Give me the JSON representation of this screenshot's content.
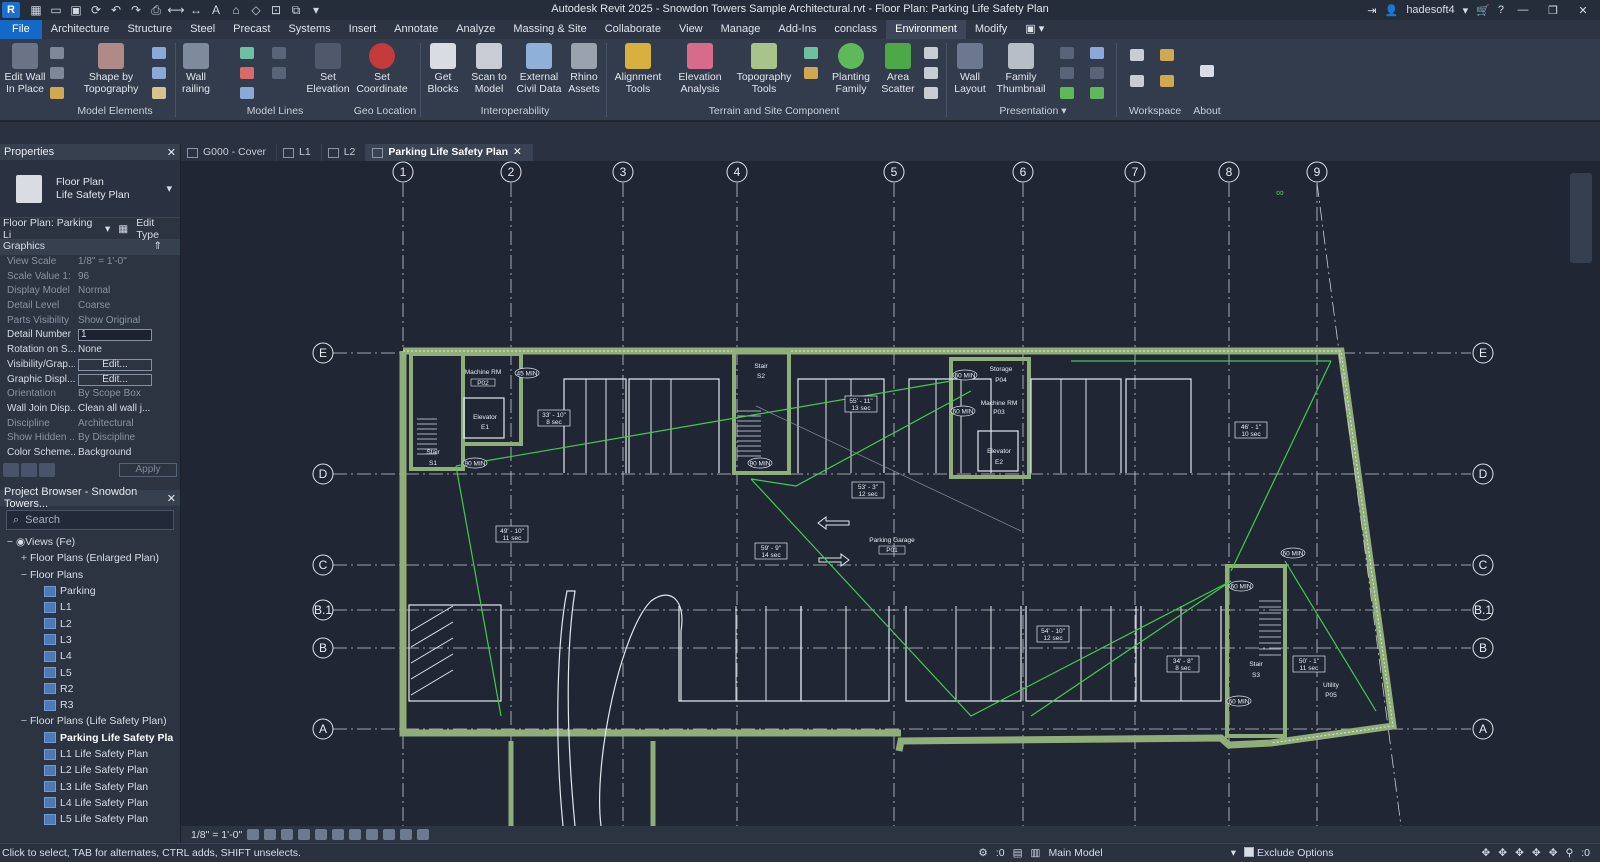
{
  "window": {
    "title": "Autodesk Revit 2025 - Snowdon Towers Sample Architectural.rvt - Floor Plan: Parking Life Safety Plan",
    "user": "hadesoft4",
    "logo": "R"
  },
  "menu": {
    "tabs": [
      "File",
      "Architecture",
      "Structure",
      "Steel",
      "Precast",
      "Systems",
      "Insert",
      "Annotate",
      "Analyze",
      "Massing & Site",
      "Collaborate",
      "View",
      "Manage",
      "Add-Ins",
      "conclass",
      "Environment",
      "Modify"
    ],
    "active": "Environment"
  },
  "ribbon": {
    "buttons": {
      "edit_wall": "Edit Wall In Place",
      "shape_topo": "Shape by Topography",
      "wall_railing": "Wall railing",
      "set_elevation": "Set Elevation",
      "set_coordinate": "Set Coordinate",
      "get_blocks": "Get Blocks",
      "scan_model": "Scan to Model",
      "external_civil": "External Civil Data",
      "rhino_assets": "Rhino Assets",
      "alignment_tools": "Alignment Tools",
      "elevation_analysis": "Elevation Analysis",
      "topography_tools": "Topography Tools",
      "planting_family": "Planting Family",
      "area_scatter": "Area Scatter",
      "wall_layout": "Wall Layout",
      "family_thumbnail": "Family Thumbnail"
    },
    "panels": {
      "model_elements": "Model Elements",
      "model_lines": "Model Lines",
      "geo_location": "Geo Location",
      "interoperability": "Interoperability",
      "terrain": "Terrain and Site Component",
      "presentation": "Presentation",
      "workspace": "Workspace",
      "about": "About"
    }
  },
  "properties": {
    "title": "Properties",
    "type_line1": "Floor Plan",
    "type_line2": "Life Safety Plan",
    "instance": "Floor Plan: Parking Li",
    "edit_type": "Edit Type",
    "section": "Graphics",
    "rows": [
      {
        "k": "View Scale",
        "v": "1/8\" = 1'-0\"",
        "dim": true,
        "kind": "text"
      },
      {
        "k": "Scale Value    1:",
        "v": "96",
        "dim": true,
        "kind": "text"
      },
      {
        "k": "Display Model",
        "v": "Normal",
        "dim": true,
        "kind": "text"
      },
      {
        "k": "Detail Level",
        "v": "Coarse",
        "dim": true,
        "kind": "text"
      },
      {
        "k": "Parts Visibility",
        "v": "Show Original",
        "dim": true,
        "kind": "text"
      },
      {
        "k": "Detail Number",
        "v": "1",
        "dim": false,
        "kind": "input"
      },
      {
        "k": "Rotation on S...",
        "v": "None",
        "dim": false,
        "kind": "text"
      },
      {
        "k": "Visibility/Grap...",
        "v": "Edit...",
        "dim": false,
        "kind": "button"
      },
      {
        "k": "Graphic Displ...",
        "v": "Edit...",
        "dim": false,
        "kind": "button"
      },
      {
        "k": "Orientation",
        "v": "By Scope Box",
        "dim": true,
        "kind": "text"
      },
      {
        "k": "Wall Join Disp...",
        "v": "Clean all wall j...",
        "dim": false,
        "kind": "text"
      },
      {
        "k": "Discipline",
        "v": "Architectural",
        "dim": true,
        "kind": "text"
      },
      {
        "k": "Show Hidden ...",
        "v": "By Discipline",
        "dim": true,
        "kind": "text"
      },
      {
        "k": "Color Scheme...",
        "v": "Background",
        "dim": false,
        "kind": "text"
      }
    ],
    "apply": "Apply"
  },
  "browser": {
    "title": "Project Browser - Snowdon Towers...",
    "search_placeholder": "Search",
    "nodes": [
      {
        "label": "Views (Fe)",
        "level": 0,
        "toggle": "−",
        "icon": false,
        "sel": false
      },
      {
        "label": "Floor Plans (Enlarged Plan)",
        "level": 1,
        "toggle": "+",
        "icon": false,
        "sel": false
      },
      {
        "label": "Floor Plans",
        "level": 1,
        "toggle": "−",
        "icon": false,
        "sel": false
      },
      {
        "label": "Parking",
        "level": 2,
        "toggle": "",
        "icon": true,
        "sel": false
      },
      {
        "label": "L1",
        "level": 2,
        "toggle": "",
        "icon": true,
        "sel": false
      },
      {
        "label": "L2",
        "level": 2,
        "toggle": "",
        "icon": true,
        "sel": false
      },
      {
        "label": "L3",
        "level": 2,
        "toggle": "",
        "icon": true,
        "sel": false
      },
      {
        "label": "L4",
        "level": 2,
        "toggle": "",
        "icon": true,
        "sel": false
      },
      {
        "label": "L5",
        "level": 2,
        "toggle": "",
        "icon": true,
        "sel": false
      },
      {
        "label": "R2",
        "level": 2,
        "toggle": "",
        "icon": true,
        "sel": false
      },
      {
        "label": "R3",
        "level": 2,
        "toggle": "",
        "icon": true,
        "sel": false
      },
      {
        "label": "Floor Plans (Life Safety Plan)",
        "level": 1,
        "toggle": "−",
        "icon": false,
        "sel": false
      },
      {
        "label": "Parking Life Safety Pla",
        "level": 2,
        "toggle": "",
        "icon": true,
        "sel": true
      },
      {
        "label": "L1 Life Safety Plan",
        "level": 2,
        "toggle": "",
        "icon": true,
        "sel": false
      },
      {
        "label": "L2 Life Safety Plan",
        "level": 2,
        "toggle": "",
        "icon": true,
        "sel": false
      },
      {
        "label": "L3 Life Safety Plan",
        "level": 2,
        "toggle": "",
        "icon": true,
        "sel": false
      },
      {
        "label": "L4 Life Safety Plan",
        "level": 2,
        "toggle": "",
        "icon": true,
        "sel": false
      },
      {
        "label": "L5 Life Safety Plan",
        "level": 2,
        "toggle": "",
        "icon": true,
        "sel": false
      }
    ]
  },
  "view_tabs": [
    {
      "label": "G000 - Cover",
      "active": false
    },
    {
      "label": "L1",
      "active": false
    },
    {
      "label": "L2",
      "active": false
    },
    {
      "label": "Parking Life Safety Plan",
      "active": true
    }
  ],
  "plan": {
    "grid_cols": [
      "1",
      "2",
      "3",
      "4",
      "5",
      "6",
      "7",
      "8",
      "9"
    ],
    "grid_rows": [
      "E",
      "D",
      "C",
      "B.1",
      "B",
      "A"
    ],
    "labels": {
      "machine_rm": "Machine RM",
      "p02": "P02",
      "elevator": "Elevator",
      "e1": "E1",
      "stair": "Stair",
      "s1": "S1",
      "s2": "S2",
      "s3": "S3",
      "storage": "Storage",
      "p04": "P04",
      "p03": "P03",
      "e2": "E2",
      "parking_garage": "Parking Garage",
      "p01": "P01",
      "utility": "Utility",
      "p05": "P05",
      "min45": "45 MIN",
      "min90": "90 MIN",
      "min60": "60 MIN"
    },
    "egress": [
      {
        "d": "33' - 10\"",
        "t": "8 sec"
      },
      {
        "d": "55' - 11\"",
        "t": "13 sec"
      },
      {
        "d": "53' - 3\"",
        "t": "12 sec"
      },
      {
        "d": "46' - 1\"",
        "t": "10 sec"
      },
      {
        "d": "49' - 10\"",
        "t": "11 sec"
      },
      {
        "d": "59' - 9\"",
        "t": "14 sec"
      },
      {
        "d": "54' - 10\"",
        "t": "12 sec"
      },
      {
        "d": "34' - 8\"",
        "t": "8 sec"
      },
      {
        "d": "50' - 1\"",
        "t": "11 sec"
      }
    ]
  },
  "view_control": {
    "scale": "1/8\" = 1'-0\""
  },
  "status": {
    "hint": "Click to select, TAB for alternates, CTRL adds, SHIFT unselects.",
    "zero": ":0",
    "model": "Main Model",
    "exclude": "Exclude Options",
    "filter": ":0"
  },
  "colors": {
    "accent": "#1468c8",
    "wall": "#7a9a6a",
    "egress": "#3fcf4a",
    "background": "#202634"
  }
}
